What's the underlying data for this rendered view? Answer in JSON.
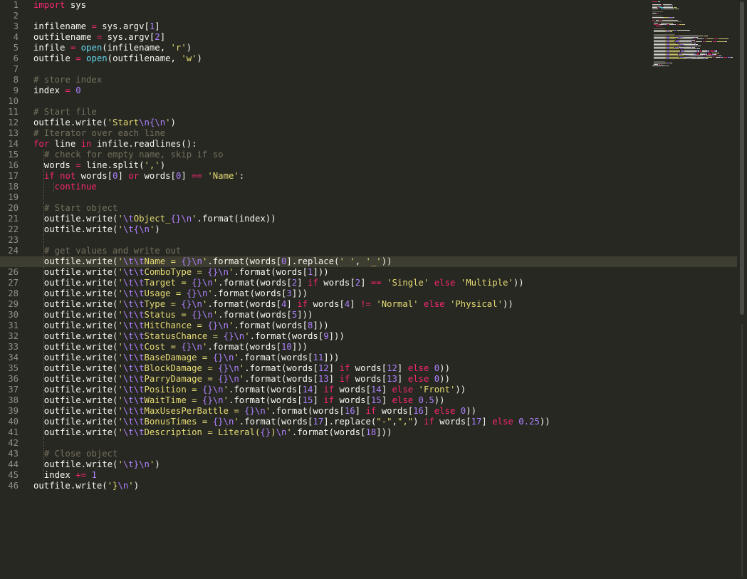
{
  "editor": {
    "active_line": 25,
    "lines": [
      [
        [
          "import",
          "kw"
        ],
        [
          " sys",
          ""
        ]
      ],
      [],
      [
        [
          "infilename ",
          ""
        ],
        [
          "=",
          "kw"
        ],
        [
          " sys.argv[",
          ""
        ],
        [
          "1",
          "nu"
        ],
        [
          "]",
          ""
        ]
      ],
      [
        [
          "outfilename ",
          ""
        ],
        [
          "=",
          "kw"
        ],
        [
          " sys.argv[",
          ""
        ],
        [
          "2",
          "nu"
        ],
        [
          "]",
          ""
        ]
      ],
      [
        [
          "infile ",
          ""
        ],
        [
          "=",
          "kw"
        ],
        [
          " ",
          ""
        ],
        [
          "open",
          "bi"
        ],
        [
          "(infilename, ",
          ""
        ],
        [
          "'r'",
          "st"
        ],
        [
          ")",
          ""
        ]
      ],
      [
        [
          "outfile ",
          ""
        ],
        [
          "=",
          "kw"
        ],
        [
          " ",
          ""
        ],
        [
          "open",
          "bi"
        ],
        [
          "(outfilename, ",
          ""
        ],
        [
          "'w'",
          "st"
        ],
        [
          ")",
          ""
        ]
      ],
      [],
      [
        [
          "# store index",
          "cm"
        ]
      ],
      [
        [
          "index ",
          ""
        ],
        [
          "=",
          "kw"
        ],
        [
          " ",
          ""
        ],
        [
          "0",
          "nu"
        ]
      ],
      [],
      [
        [
          "# Start file",
          "cm"
        ]
      ],
      [
        [
          "outfile.write(",
          ""
        ],
        [
          "'Start",
          "st"
        ],
        [
          "\\n{\\n",
          "nu"
        ],
        [
          "'",
          "st"
        ],
        [
          ")",
          ""
        ]
      ],
      [
        [
          "# Iterator over each line",
          "cm"
        ]
      ],
      [
        [
          "for",
          "kw"
        ],
        [
          " line ",
          ""
        ],
        [
          "in",
          "kw"
        ],
        [
          " infile.readlines():",
          ""
        ]
      ],
      [
        [
          "  ",
          ""
        ],
        [
          "# check for empty name, skip if so",
          "cm"
        ]
      ],
      [
        [
          "  words ",
          ""
        ],
        [
          "=",
          "kw"
        ],
        [
          " line.split(",
          ""
        ],
        [
          "','",
          "st"
        ],
        [
          ")",
          ""
        ]
      ],
      [
        [
          "  ",
          ""
        ],
        [
          "if",
          "kw"
        ],
        [
          " ",
          ""
        ],
        [
          "not",
          "kw"
        ],
        [
          " words[",
          ""
        ],
        [
          "0",
          "nu"
        ],
        [
          "] ",
          ""
        ],
        [
          "or",
          "kw"
        ],
        [
          " words[",
          ""
        ],
        [
          "0",
          "nu"
        ],
        [
          "] ",
          ""
        ],
        [
          "==",
          "kw"
        ],
        [
          " ",
          ""
        ],
        [
          "'Name'",
          "st"
        ],
        [
          ":",
          ""
        ]
      ],
      [
        [
          "    ",
          ""
        ],
        [
          "continue",
          "kw"
        ]
      ],
      [],
      [
        [
          "  ",
          ""
        ],
        [
          "# Start object",
          "cm"
        ]
      ],
      [
        [
          "  outfile.write(",
          ""
        ],
        [
          "'",
          "st"
        ],
        [
          "\\t",
          "nu"
        ],
        [
          "Object_",
          "st"
        ],
        [
          "{}",
          "nu"
        ],
        [
          "\\n",
          "nu"
        ],
        [
          "'",
          "st"
        ],
        [
          ".format(index))",
          ""
        ]
      ],
      [
        [
          "  outfile.write(",
          ""
        ],
        [
          "'",
          "st"
        ],
        [
          "\\t{\\n",
          "nu"
        ],
        [
          "'",
          "st"
        ],
        [
          ")",
          ""
        ]
      ],
      [],
      [
        [
          "  ",
          ""
        ],
        [
          "# get values and write out",
          "cm"
        ]
      ],
      [
        [
          "  outfile.write(",
          ""
        ],
        [
          "'",
          "st"
        ],
        [
          "\\t\\t",
          "nu"
        ],
        [
          "Name = ",
          "st"
        ],
        [
          "{}\\n",
          "nu"
        ],
        [
          "'",
          "st"
        ],
        [
          ".format(words[",
          ""
        ],
        [
          "0",
          "nu"
        ],
        [
          "].replace(",
          ""
        ],
        [
          "' '",
          "st"
        ],
        [
          ", ",
          ""
        ],
        [
          "'_'",
          "st"
        ],
        [
          "))",
          ""
        ]
      ],
      [
        [
          "  outfile.write(",
          ""
        ],
        [
          "'",
          "st"
        ],
        [
          "\\t\\t",
          "nu"
        ],
        [
          "ComboType = ",
          "st"
        ],
        [
          "{}\\n",
          "nu"
        ],
        [
          "'",
          "st"
        ],
        [
          ".format(words[",
          ""
        ],
        [
          "1",
          "nu"
        ],
        [
          "]))",
          ""
        ]
      ],
      [
        [
          "  outfile.write(",
          ""
        ],
        [
          "'",
          "st"
        ],
        [
          "\\t\\t",
          "nu"
        ],
        [
          "Target = ",
          "st"
        ],
        [
          "{}\\n",
          "nu"
        ],
        [
          "'",
          "st"
        ],
        [
          ".format(words[",
          ""
        ],
        [
          "2",
          "nu"
        ],
        [
          "] ",
          ""
        ],
        [
          "if",
          "kw"
        ],
        [
          " words[",
          ""
        ],
        [
          "2",
          "nu"
        ],
        [
          "] ",
          ""
        ],
        [
          "==",
          "kw"
        ],
        [
          " ",
          ""
        ],
        [
          "'Single'",
          "st"
        ],
        [
          " ",
          ""
        ],
        [
          "else",
          "kw"
        ],
        [
          " ",
          ""
        ],
        [
          "'Multiple'",
          "st"
        ],
        [
          "))",
          ""
        ]
      ],
      [
        [
          "  outfile.write(",
          ""
        ],
        [
          "'",
          "st"
        ],
        [
          "\\t\\t",
          "nu"
        ],
        [
          "Usage = ",
          "st"
        ],
        [
          "{}\\n",
          "nu"
        ],
        [
          "'",
          "st"
        ],
        [
          ".format(words[",
          ""
        ],
        [
          "3",
          "nu"
        ],
        [
          "]))",
          ""
        ]
      ],
      [
        [
          "  outfile.write(",
          ""
        ],
        [
          "'",
          "st"
        ],
        [
          "\\t\\t",
          "nu"
        ],
        [
          "Type = ",
          "st"
        ],
        [
          "{}\\n",
          "nu"
        ],
        [
          "'",
          "st"
        ],
        [
          ".format(words[",
          ""
        ],
        [
          "4",
          "nu"
        ],
        [
          "] ",
          ""
        ],
        [
          "if",
          "kw"
        ],
        [
          " words[",
          ""
        ],
        [
          "4",
          "nu"
        ],
        [
          "] ",
          ""
        ],
        [
          "!=",
          "kw"
        ],
        [
          " ",
          ""
        ],
        [
          "'Normal'",
          "st"
        ],
        [
          " ",
          ""
        ],
        [
          "else",
          "kw"
        ],
        [
          " ",
          ""
        ],
        [
          "'Physical'",
          "st"
        ],
        [
          "))",
          ""
        ]
      ],
      [
        [
          "  outfile.write(",
          ""
        ],
        [
          "'",
          "st"
        ],
        [
          "\\t\\t",
          "nu"
        ],
        [
          "Status = ",
          "st"
        ],
        [
          "{}\\n",
          "nu"
        ],
        [
          "'",
          "st"
        ],
        [
          ".format(words[",
          ""
        ],
        [
          "5",
          "nu"
        ],
        [
          "]))",
          ""
        ]
      ],
      [
        [
          "  outfile.write(",
          ""
        ],
        [
          "'",
          "st"
        ],
        [
          "\\t\\t",
          "nu"
        ],
        [
          "HitChance = ",
          "st"
        ],
        [
          "{}\\n",
          "nu"
        ],
        [
          "'",
          "st"
        ],
        [
          ".format(words[",
          ""
        ],
        [
          "8",
          "nu"
        ],
        [
          "]))",
          ""
        ]
      ],
      [
        [
          "  outfile.write(",
          ""
        ],
        [
          "'",
          "st"
        ],
        [
          "\\t\\t",
          "nu"
        ],
        [
          "StatusChance = ",
          "st"
        ],
        [
          "{}\\n",
          "nu"
        ],
        [
          "'",
          "st"
        ],
        [
          ".format(words[",
          ""
        ],
        [
          "9",
          "nu"
        ],
        [
          "]))",
          ""
        ]
      ],
      [
        [
          "  outfile.write(",
          ""
        ],
        [
          "'",
          "st"
        ],
        [
          "\\t\\t",
          "nu"
        ],
        [
          "Cost = ",
          "st"
        ],
        [
          "{}\\n",
          "nu"
        ],
        [
          "'",
          "st"
        ],
        [
          ".format(words[",
          ""
        ],
        [
          "10",
          "nu"
        ],
        [
          "]))",
          ""
        ]
      ],
      [
        [
          "  outfile.write(",
          ""
        ],
        [
          "'",
          "st"
        ],
        [
          "\\t\\t",
          "nu"
        ],
        [
          "BaseDamage = ",
          "st"
        ],
        [
          "{}\\n",
          "nu"
        ],
        [
          "'",
          "st"
        ],
        [
          ".format(words[",
          ""
        ],
        [
          "11",
          "nu"
        ],
        [
          "]))",
          ""
        ]
      ],
      [
        [
          "  outfile.write(",
          ""
        ],
        [
          "'",
          "st"
        ],
        [
          "\\t\\t",
          "nu"
        ],
        [
          "BlockDamage = ",
          "st"
        ],
        [
          "{}\\n",
          "nu"
        ],
        [
          "'",
          "st"
        ],
        [
          ".format(words[",
          ""
        ],
        [
          "12",
          "nu"
        ],
        [
          "] ",
          ""
        ],
        [
          "if",
          "kw"
        ],
        [
          " words[",
          ""
        ],
        [
          "12",
          "nu"
        ],
        [
          "] ",
          ""
        ],
        [
          "else",
          "kw"
        ],
        [
          " ",
          ""
        ],
        [
          "0",
          "nu"
        ],
        [
          "))",
          ""
        ]
      ],
      [
        [
          "  outfile.write(",
          ""
        ],
        [
          "'",
          "st"
        ],
        [
          "\\t\\t",
          "nu"
        ],
        [
          "ParryDamage = ",
          "st"
        ],
        [
          "{}\\n",
          "nu"
        ],
        [
          "'",
          "st"
        ],
        [
          ".format(words[",
          ""
        ],
        [
          "13",
          "nu"
        ],
        [
          "] ",
          ""
        ],
        [
          "if",
          "kw"
        ],
        [
          " words[",
          ""
        ],
        [
          "13",
          "nu"
        ],
        [
          "] ",
          ""
        ],
        [
          "else",
          "kw"
        ],
        [
          " ",
          ""
        ],
        [
          "0",
          "nu"
        ],
        [
          "))",
          ""
        ]
      ],
      [
        [
          "  outfile.write(",
          ""
        ],
        [
          "'",
          "st"
        ],
        [
          "\\t\\t",
          "nu"
        ],
        [
          "Position = ",
          "st"
        ],
        [
          "{}\\n",
          "nu"
        ],
        [
          "'",
          "st"
        ],
        [
          ".format(words[",
          ""
        ],
        [
          "14",
          "nu"
        ],
        [
          "] ",
          ""
        ],
        [
          "if",
          "kw"
        ],
        [
          " words[",
          ""
        ],
        [
          "14",
          "nu"
        ],
        [
          "] ",
          ""
        ],
        [
          "else",
          "kw"
        ],
        [
          " ",
          ""
        ],
        [
          "'Front'",
          "st"
        ],
        [
          "))",
          ""
        ]
      ],
      [
        [
          "  outfile.write(",
          ""
        ],
        [
          "'",
          "st"
        ],
        [
          "\\t\\t",
          "nu"
        ],
        [
          "WaitTime = ",
          "st"
        ],
        [
          "{}\\n",
          "nu"
        ],
        [
          "'",
          "st"
        ],
        [
          ".format(words[",
          ""
        ],
        [
          "15",
          "nu"
        ],
        [
          "] ",
          ""
        ],
        [
          "if",
          "kw"
        ],
        [
          " words[",
          ""
        ],
        [
          "15",
          "nu"
        ],
        [
          "] ",
          ""
        ],
        [
          "else",
          "kw"
        ],
        [
          " ",
          ""
        ],
        [
          "0.5",
          "nu"
        ],
        [
          "))",
          ""
        ]
      ],
      [
        [
          "  outfile.write(",
          ""
        ],
        [
          "'",
          "st"
        ],
        [
          "\\t\\t",
          "nu"
        ],
        [
          "MaxUsesPerBattle = ",
          "st"
        ],
        [
          "{}\\n",
          "nu"
        ],
        [
          "'",
          "st"
        ],
        [
          ".format(words[",
          ""
        ],
        [
          "16",
          "nu"
        ],
        [
          "] ",
          ""
        ],
        [
          "if",
          "kw"
        ],
        [
          " words[",
          ""
        ],
        [
          "16",
          "nu"
        ],
        [
          "] ",
          ""
        ],
        [
          "else",
          "kw"
        ],
        [
          " ",
          ""
        ],
        [
          "0",
          "nu"
        ],
        [
          "))",
          ""
        ]
      ],
      [
        [
          "  outfile.write(",
          ""
        ],
        [
          "'",
          "st"
        ],
        [
          "\\t\\t",
          "nu"
        ],
        [
          "BonusTimes = ",
          "st"
        ],
        [
          "{}\\n",
          "nu"
        ],
        [
          "'",
          "st"
        ],
        [
          ".format(words[",
          ""
        ],
        [
          "17",
          "nu"
        ],
        [
          "].replace(",
          ""
        ],
        [
          "\"-\"",
          "st"
        ],
        [
          ",",
          ""
        ],
        [
          "\",\"",
          "st"
        ],
        [
          ") ",
          ""
        ],
        [
          "if",
          "kw"
        ],
        [
          " words[",
          ""
        ],
        [
          "17",
          "nu"
        ],
        [
          "] ",
          ""
        ],
        [
          "else",
          "kw"
        ],
        [
          " ",
          ""
        ],
        [
          "0.25",
          "nu"
        ],
        [
          "))",
          ""
        ]
      ],
      [
        [
          "  outfile.write(",
          ""
        ],
        [
          "'",
          "st"
        ],
        [
          "\\t\\t",
          "nu"
        ],
        [
          "Description = Literal(",
          "st"
        ],
        [
          "{}",
          "nu"
        ],
        [
          ")",
          "st"
        ],
        [
          "\\n",
          "nu"
        ],
        [
          "'",
          "st"
        ],
        [
          ".format(words[",
          ""
        ],
        [
          "18",
          "nu"
        ],
        [
          "]))",
          ""
        ]
      ],
      [],
      [
        [
          "  ",
          ""
        ],
        [
          "# Close object",
          "cm"
        ]
      ],
      [
        [
          "  outfile.write(",
          ""
        ],
        [
          "'",
          "st"
        ],
        [
          "\\t}\\n",
          "nu"
        ],
        [
          "'",
          "st"
        ],
        [
          ")",
          ""
        ]
      ],
      [
        [
          "  index ",
          ""
        ],
        [
          "+=",
          "kw"
        ],
        [
          " ",
          ""
        ],
        [
          "1",
          "nu"
        ]
      ],
      [
        [
          "outfile.write(",
          ""
        ],
        [
          "'}",
          "st"
        ],
        [
          "\\n",
          "nu"
        ],
        [
          "'",
          "st"
        ],
        [
          ")",
          ""
        ]
      ]
    ]
  },
  "colors": {
    "background": "#272822",
    "foreground": "#f8f8f2",
    "keyword": "#f92672",
    "string": "#e6db74",
    "number": "#ae81ff",
    "comment": "#75715e",
    "builtin": "#66d9ef",
    "line_highlight": "#3e3d32"
  }
}
